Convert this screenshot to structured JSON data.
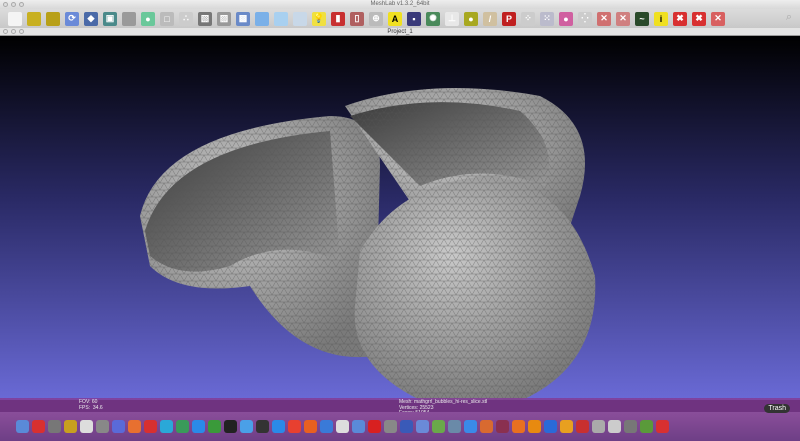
{
  "window": {
    "title": "MeshLab v1.3.2_64bit",
    "document_title": "Project_1"
  },
  "toolbar": {
    "icons": [
      {
        "name": "new-file-icon",
        "color": "#f4f4f4",
        "glyph": ""
      },
      {
        "name": "open-folder-icon",
        "color": "#c8b020",
        "glyph": ""
      },
      {
        "name": "import-folder-icon",
        "color": "#b8a018",
        "glyph": ""
      },
      {
        "name": "reload-icon",
        "color": "#6a8ad8",
        "glyph": "⟳"
      },
      {
        "name": "save-icon",
        "color": "#4a6aa8",
        "glyph": "◆"
      },
      {
        "name": "snapshot-icon",
        "color": "#4a8a8a",
        "glyph": "▣"
      },
      {
        "name": "layers-icon",
        "color": "#9a9a9a",
        "glyph": ""
      },
      {
        "name": "globe-icon",
        "color": "#6ac89a",
        "glyph": "●"
      },
      {
        "name": "bbox-icon",
        "color": "#bbbbbb",
        "glyph": "□"
      },
      {
        "name": "points-icon",
        "color": "#cccccc",
        "glyph": "∴"
      },
      {
        "name": "wireframe-icon",
        "color": "#777777",
        "glyph": "▧"
      },
      {
        "name": "hidden-lines-icon",
        "color": "#999999",
        "glyph": "▨"
      },
      {
        "name": "flat-lines-icon",
        "color": "#6a8ac8",
        "glyph": "▩"
      },
      {
        "name": "flat-icon",
        "color": "#7ab0e8",
        "glyph": ""
      },
      {
        "name": "smooth-icon",
        "color": "#a8d0f0",
        "glyph": ""
      },
      {
        "name": "texture-icon",
        "color": "#c8d8e8",
        "glyph": ""
      },
      {
        "name": "light-bulb-icon",
        "color": "#f0e040",
        "glyph": "💡"
      },
      {
        "name": "double-side-icon",
        "color": "#c83030",
        "glyph": "▮"
      },
      {
        "name": "color-mode-icon",
        "color": "#b06060",
        "glyph": "▯"
      },
      {
        "name": "trackball-icon",
        "color": "#bbbbbb",
        "glyph": "⊕"
      },
      {
        "name": "annotation-icon",
        "color": "#f0e020",
        "glyph": "A"
      },
      {
        "name": "raster-icon",
        "color": "#3a3a7a",
        "glyph": "▪"
      },
      {
        "name": "align-icon",
        "color": "#4a8a5a",
        "glyph": "✺"
      },
      {
        "name": "axis-icon",
        "color": "#e8e8e8",
        "glyph": "⊥"
      },
      {
        "name": "paint-icon",
        "color": "#a8a820",
        "glyph": "●"
      },
      {
        "name": "brush-icon",
        "color": "#d0c0a0",
        "glyph": "/"
      },
      {
        "name": "pickpoints-icon",
        "color": "#c02020",
        "glyph": "P"
      },
      {
        "name": "select-vertices-icon",
        "color": "#cccccc",
        "glyph": "⁘"
      },
      {
        "name": "select-connected-icon",
        "color": "#bbbbcc",
        "glyph": "⁙"
      },
      {
        "name": "fruit-icon",
        "color": "#d060a0",
        "glyph": "●"
      },
      {
        "name": "select-rect-icon",
        "color": "#cccccc",
        "glyph": "⁛"
      },
      {
        "name": "select-faces-icon",
        "color": "#d07070",
        "glyph": "✕"
      },
      {
        "name": "select-area-icon",
        "color": "#d08080",
        "glyph": "✕"
      },
      {
        "name": "measure-icon",
        "color": "#2a4a2a",
        "glyph": "~"
      },
      {
        "name": "info-icon",
        "color": "#f0e020",
        "glyph": "i"
      },
      {
        "name": "delete-faces-icon",
        "color": "#d83030",
        "glyph": "✖"
      },
      {
        "name": "delete-vertices-icon",
        "color": "#d83030",
        "glyph": "✖"
      },
      {
        "name": "delete-selection-icon",
        "color": "#d86060",
        "glyph": "✕"
      }
    ]
  },
  "viewport": {
    "fov_label": "FOV:",
    "fov": "60",
    "fps_label": "FPS:",
    "fps": "34.6",
    "mesh_label": "Mesh:",
    "mesh": "mathgrrl_bubbles_hi-res_slice.stl",
    "vertices_label": "Vertices:",
    "vertices": "25523",
    "faces_label": "Faces:",
    "faces": "51054"
  },
  "dock": {
    "trash_label": "Trash",
    "apps": [
      "#5a8ad8",
      "#d83030",
      "#777",
      "#c8a020",
      "#dddddd",
      "#888",
      "#5a6ad8",
      "#e87030",
      "#d83030",
      "#2aa8d8",
      "#3a9a5a",
      "#2a8ae8",
      "#3a9a3a",
      "#222",
      "#4aa0e8",
      "#333",
      "#2a8ae8",
      "#e84030",
      "#e86020",
      "#3a7ad8",
      "#ddd",
      "#5a8ad8",
      "#d82020",
      "#888",
      "#3a5ab8",
      "#6a8ad8",
      "#6aa84a",
      "#6a8aa8",
      "#3a8ae8",
      "#d86a30",
      "#8a3050",
      "#e87020",
      "#e88a10",
      "#2a6ad8",
      "#e8a020",
      "#c83030",
      "#aaa",
      "#ccc",
      "#777",
      "#5a9a3a",
      "#d83030"
    ]
  }
}
